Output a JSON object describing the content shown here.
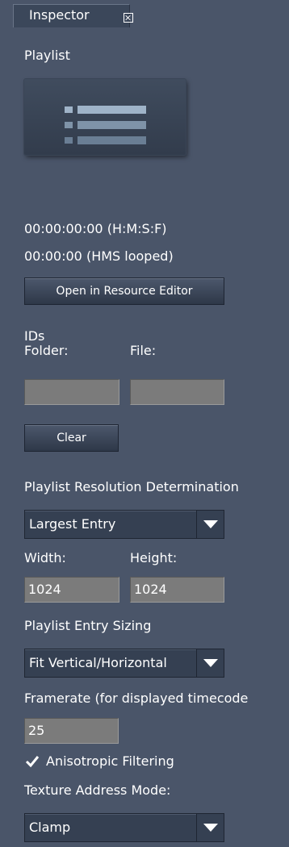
{
  "tab": {
    "label": "Inspector"
  },
  "section_title": "Playlist",
  "thumbnail": {
    "icon": "playlist-icon"
  },
  "timecode": {
    "hmsf": "00:00:00:00 (H:M:S:F)",
    "hms_looped": "00:00:00 (HMS looped)"
  },
  "buttons": {
    "open_editor": "Open in Resource Editor",
    "clear": "Clear"
  },
  "ids": {
    "label": "IDs",
    "folder_label": "Folder:",
    "file_label": "File:",
    "folder_value": "",
    "file_value": ""
  },
  "resolution": {
    "label": "Playlist Resolution Determination",
    "selected": "Largest Entry",
    "width_label": "Width:",
    "height_label": "Height:",
    "width_value": "1024",
    "height_value": "1024"
  },
  "sizing": {
    "label": "Playlist Entry Sizing",
    "selected": "Fit Vertical/Horizontal"
  },
  "framerate": {
    "label": "Framerate (for displayed timecode",
    "value": "25"
  },
  "anisotropic": {
    "label": "Anisotropic Filtering",
    "checked": true
  },
  "texture_address": {
    "label": "Texture Address Mode:",
    "selected": "Clamp"
  },
  "colors": {
    "panel_bg": "#4a5569",
    "field_bg": "#7b7b7b",
    "control_bg": "#354052"
  }
}
